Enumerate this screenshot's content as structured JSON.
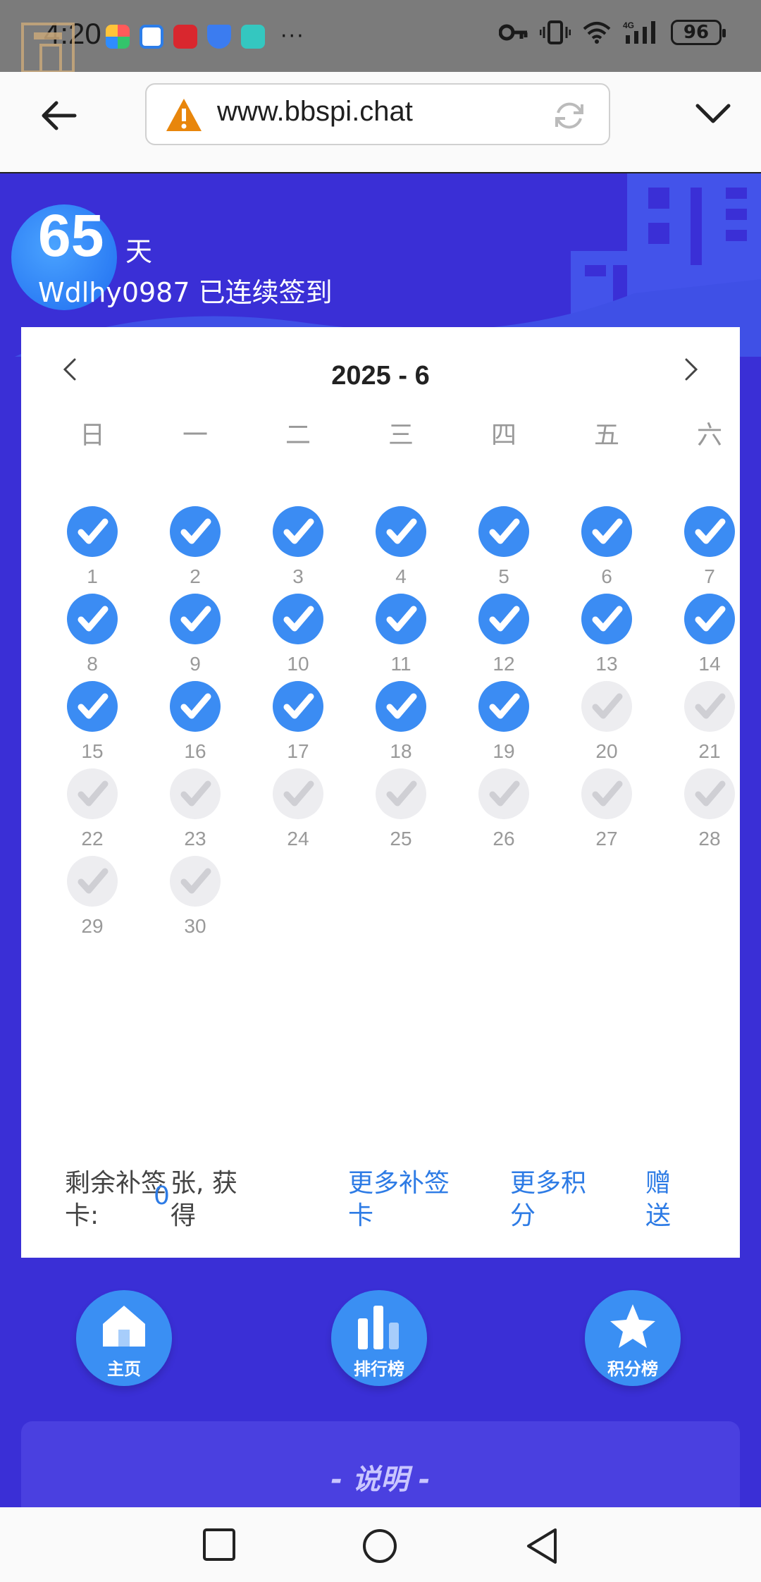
{
  "status_bar": {
    "time": "4:20",
    "battery": "96",
    "dots": "···"
  },
  "browser": {
    "url": "www.bbspi.chat"
  },
  "header": {
    "days": "65",
    "days_unit": "天",
    "user_line": "Wdlhy0987 已连续签到"
  },
  "calendar": {
    "title": "2025 - 6",
    "weekdays": [
      "日",
      "一",
      "二",
      "三",
      "四",
      "五",
      "六"
    ],
    "days": [
      {
        "num": "1",
        "signed": true
      },
      {
        "num": "2",
        "signed": true
      },
      {
        "num": "3",
        "signed": true
      },
      {
        "num": "4",
        "signed": true
      },
      {
        "num": "5",
        "signed": true
      },
      {
        "num": "6",
        "signed": true
      },
      {
        "num": "7",
        "signed": true
      },
      {
        "num": "8",
        "signed": true
      },
      {
        "num": "9",
        "signed": true
      },
      {
        "num": "10",
        "signed": true
      },
      {
        "num": "11",
        "signed": true
      },
      {
        "num": "12",
        "signed": true
      },
      {
        "num": "13",
        "signed": true
      },
      {
        "num": "14",
        "signed": true
      },
      {
        "num": "15",
        "signed": true
      },
      {
        "num": "16",
        "signed": true
      },
      {
        "num": "17",
        "signed": true
      },
      {
        "num": "18",
        "signed": true
      },
      {
        "num": "19",
        "signed": true
      },
      {
        "num": "20",
        "signed": false
      },
      {
        "num": "21",
        "signed": false
      },
      {
        "num": "22",
        "signed": false
      },
      {
        "num": "23",
        "signed": false
      },
      {
        "num": "24",
        "signed": false
      },
      {
        "num": "25",
        "signed": false
      },
      {
        "num": "26",
        "signed": false
      },
      {
        "num": "27",
        "signed": false
      },
      {
        "num": "28",
        "signed": false
      },
      {
        "num": "29",
        "signed": false
      },
      {
        "num": "30",
        "signed": false
      }
    ]
  },
  "footer": {
    "remaining_label_1": "剩余补签",
    "remaining_label_2": "卡:",
    "count": "0",
    "unit_1": "张, 获",
    "unit_2": "得",
    "more_cards_1": "更多补签",
    "more_cards_2": "卡",
    "more_points_1": "更多积",
    "more_points_2": "分",
    "gift_1": "赠",
    "gift_2": "送"
  },
  "bottom_nav": {
    "home": "主页",
    "rank": "排行榜",
    "points_rank": "积分榜"
  },
  "notice": {
    "title": "- 说明 -"
  },
  "colors": {
    "bg": "#3a2fd6",
    "accent": "#3b8cf3",
    "link": "#2d7be5"
  }
}
